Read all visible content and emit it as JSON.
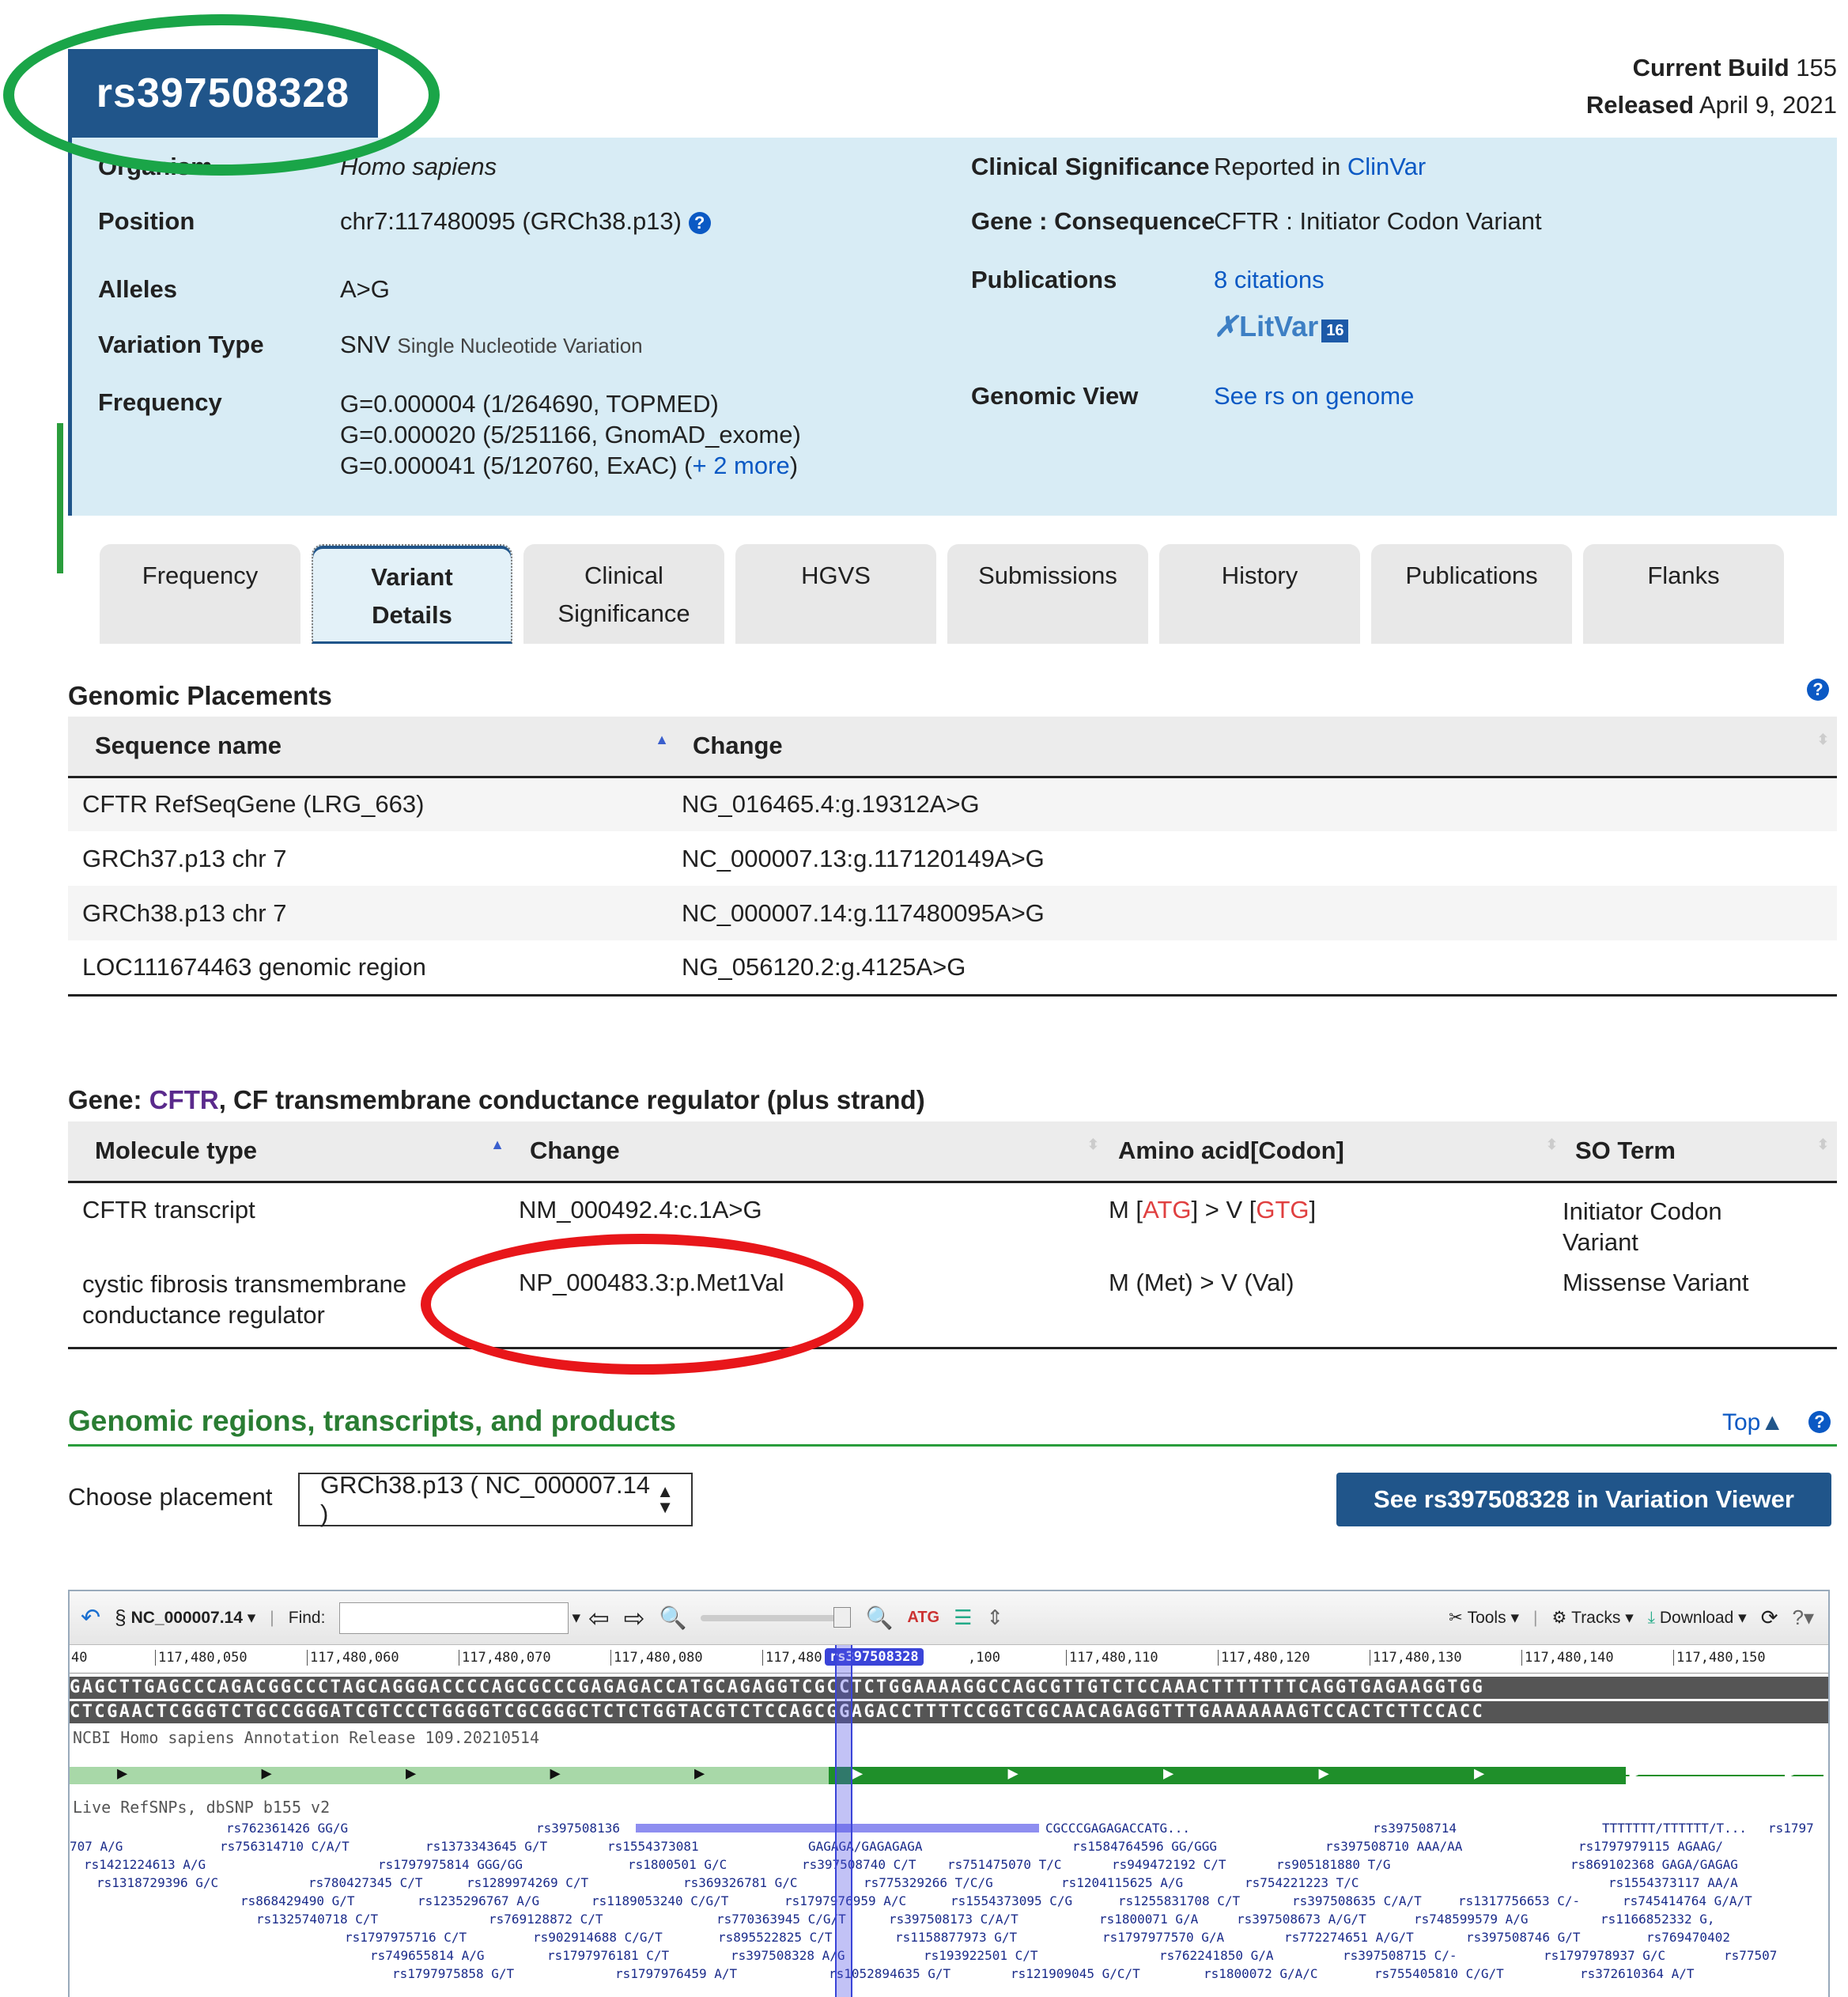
{
  "rs_id": "rs397508328",
  "build": {
    "label": "Current Build",
    "value": "155",
    "released_label": "Released",
    "released_value": "April 9, 2021"
  },
  "summary": {
    "organism_label": "Organism",
    "organism": "Homo sapiens",
    "position_label": "Position",
    "position": "chr7:117480095 (GRCh38.p13)",
    "alleles_label": "Alleles",
    "alleles": "A>G",
    "vartype_label": "Variation Type",
    "vartype": "SNV",
    "vartype_desc": "Single Nucleotide Variation",
    "frequency_label": "Frequency",
    "freq1": "G=0.000004 (1/264690, TOPMED)",
    "freq2": "G=0.000020 (5/251166, GnomAD_exome)",
    "freq3": "G=0.000041 (5/120760, ExAC) (",
    "freq3_more": "+ 2 more",
    "freq3_end": ")",
    "clinsig_label": "Clinical Significance",
    "clinsig_text": "Reported in ",
    "clinsig_link": "ClinVar",
    "gene_label": "Gene : Consequence",
    "gene_value": "CFTR : Initiator Codon Variant",
    "pubs_label": "Publications",
    "pubs_link": "8 citations",
    "litvar": "LitVar",
    "litvar_count": "16",
    "genomic_label": "Genomic View",
    "genomic_link": "See rs on genome"
  },
  "tabs": [
    {
      "line1": "Frequency",
      "line2": ""
    },
    {
      "line1": "Variant",
      "line2": "Details"
    },
    {
      "line1": "Clinical",
      "line2": "Significance"
    },
    {
      "line1": "HGVS",
      "line2": ""
    },
    {
      "line1": "Submissions",
      "line2": ""
    },
    {
      "line1": "History",
      "line2": ""
    },
    {
      "line1": "Publications",
      "line2": ""
    },
    {
      "line1": "Flanks",
      "line2": ""
    }
  ],
  "placements": {
    "title": "Genomic Placements",
    "col1": "Sequence name",
    "col2": "Change",
    "rows": [
      {
        "name": "CFTR RefSeqGene (LRG_663)",
        "change": "NG_016465.4:g.19312A>G"
      },
      {
        "name": "GRCh37.p13 chr 7",
        "change": "NC_000007.13:g.117120149A>G"
      },
      {
        "name": "GRCh38.p13 chr 7",
        "change": "NC_000007.14:g.117480095A>G"
      },
      {
        "name": "LOC111674463 genomic region",
        "change": "NG_056120.2:g.4125A>G"
      }
    ]
  },
  "gene": {
    "prefix": "Gene: ",
    "symbol": "CFTR",
    "suffix": ", CF transmembrane conductance regulator (plus strand)",
    "col1": "Molecule type",
    "col2": "Change",
    "col3": "Amino acid[Codon]",
    "col4": "SO Term",
    "r1_mol": "CFTR transcript",
    "r1_change": "NM_000492.4:c.1A>G",
    "r1_aa_a": "M [",
    "r1_aa_b": "ATG",
    "r1_aa_c": "] > V [",
    "r1_aa_d": "GTG",
    "r1_aa_e": "]",
    "r1_so1": "Initiator Codon",
    "r1_so2": "Variant",
    "r2_mol1": "cystic fibrosis transmembrane",
    "r2_mol2": "conductance regulator",
    "r2_change": "NP_000483.3:p.Met1Val",
    "r2_aa": "M (Met) > V (Val)",
    "r2_so": "Missense Variant"
  },
  "regions": {
    "title": "Genomic regions, transcripts, and products",
    "top": "Top",
    "choose_label": "Choose placement",
    "choose_value": "GRCh38.p13 ( NC_000007.14 )",
    "viewer_button": "See rs397508328 in Variation Viewer"
  },
  "viewer": {
    "seq_id": "NC_000007.14",
    "find_label": "Find:",
    "tools": "Tools",
    "tracks": "Tracks",
    "download": "Download",
    "ruler": [
      "40",
      "117,480,050",
      "117,480,060",
      "117,480,070",
      "117,480,080",
      "117,480",
      "rs397508328",
      ",100",
      "117,480,110",
      "117,480,120",
      "117,480,130",
      "117,480,140",
      "117,480,150"
    ],
    "seq_fwd": "GAGCTTGAGCCCAGACGGCCCTAGCAGGGACCCCAGCGCCCGAGAGACCATGCAGAGGTCGCCTCTGGAAAAGGCCAGCGTTGTCTCCAAACTTTTTTTCAGGTGAGAAGGTGG",
    "seq_rev": "CTCGAACTCGGGTCTGCCGGGATCGTCCCTGGGGTCGCGGGCTCTCTGGTACGTCTCCAGCGGAGACCTTTTCCGGTCGCAACAGAGGTTTGAAAAAAAGTCCACTCTTCCACC",
    "annot_track": "NCBI Homo sapiens Annotation Release 109.20210514",
    "snp_track": "Live RefSNPs, dbSNP b155 v2",
    "snp_rows": [
      [
        "rs762361426 GG/G",
        "rs397508136",
        "CGCCCGAGAGACCATG...",
        "rs397508714",
        "TTTTTTT/TTTTTT/T...",
        "rs1797"
      ],
      [
        "707 A/G",
        "rs756314710 C/A/T",
        "rs1373343645 G/T",
        "rs1554373081",
        "GAGAGA/GAGAGAGA",
        "rs1584764596 GG/GGG",
        "rs397508710 AAA/AA",
        "rs1797979115 AGAAG/"
      ],
      [
        "rs1421224613 A/G",
        "rs1797975814 GGG/GG",
        "rs1800501 G/C",
        "rs397508740 C/T",
        "rs751475070 T/C",
        "rs949472192 C/T",
        "rs905181880 T/G",
        "rs869102368 GAGA/GAGAG"
      ],
      [
        "rs1318729396 G/C",
        "rs780427345 C/T",
        "rs1289974269 C/T",
        "rs369326781 G/C",
        "rs775329266 T/C/G",
        "rs1204115625 A/G",
        "rs754221223 T/C",
        "rs1554373117 AA/A"
      ],
      [
        "rs868429490 G/T",
        "rs1235296767 A/G",
        "rs1189053240 C/G/T",
        "rs1797976959 A/C",
        "rs1554373095 C/G",
        "rs1255831708 C/T",
        "rs397508635 C/A/T",
        "rs1317756653 C/-",
        "rs745414764 G/A/T"
      ],
      [
        "rs1325740718 C/T",
        "rs769128872 C/T",
        "rs770363945 C/G/T",
        "rs397508173 C/A/T",
        "rs1800071 G/A",
        "rs397508673 A/G/T",
        "rs748599579 A/G",
        "rs1166852332 G,"
      ],
      [
        "rs1797975716 C/T",
        "rs902914688 C/G/T",
        "rs895522825 C/T",
        "rs1158877973 G/T",
        "rs1797977570 G/A",
        "rs772274651 A/G/T",
        "rs397508746 G/T",
        "rs769470402"
      ],
      [
        "rs749655814 A/G",
        "rs1797976181 C/T",
        "rs397508328 A/G",
        "rs193922501 C/T",
        "rs762241850 G/A",
        "rs397508715 C/-",
        "rs1797978937 G/C",
        "rs77507"
      ],
      [
        "rs1797975858 G/T",
        "rs1797976459 A/T",
        "rs1052894635 G/T",
        "rs121909045 G/C/T",
        "rs1800072 G/A/C",
        "rs755405810 C/G/T",
        "rs372610364 A/T"
      ]
    ]
  }
}
